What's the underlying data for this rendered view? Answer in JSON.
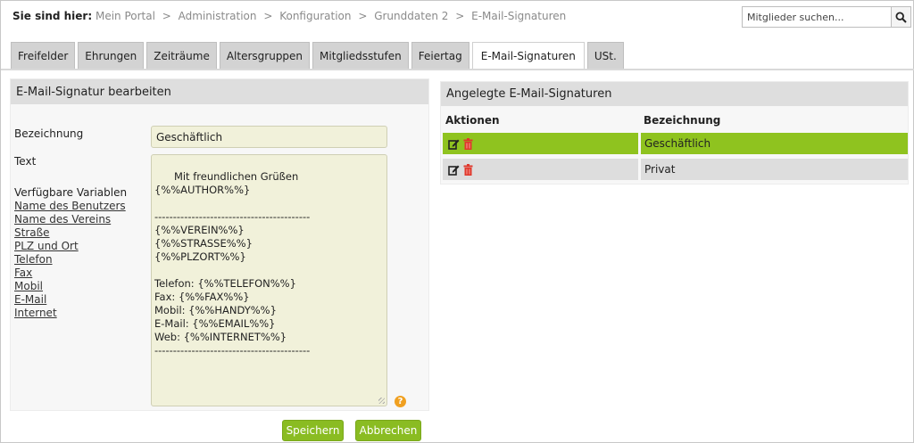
{
  "breadcrumb": {
    "lead": "Sie sind hier:",
    "items": [
      "Mein Portal",
      "Administration",
      "Konfiguration",
      "Grunddaten 2",
      "E-Mail-Signaturen"
    ],
    "separator": ">"
  },
  "search": {
    "placeholder": "Mitglieder suchen..."
  },
  "tabs": [
    "Freifelder",
    "Ehrungen",
    "Zeiträume",
    "Altersgruppen",
    "Mitgliedsstufen",
    "Feiertag",
    "E-Mail-Signaturen",
    "USt."
  ],
  "active_tab": "E-Mail-Signaturen",
  "edit_panel": {
    "title": "E-Mail-Signatur bearbeiten",
    "label_name": "Bezeichnung",
    "name_value": "Geschäftlich",
    "label_text": "Text",
    "text_value": "Mit freundlichen Grüßen\n{%%AUTHOR%%}\n\n------------------------------------------\n{%%VEREIN%%}\n{%%STRASSE%%}\n{%%PLZORT%%}\n\nTelefon: {%%TELEFON%%}\nFax: {%%FAX%%}\nMobil: {%%HANDY%%}\nE-Mail: {%%EMAIL%%}\nWeb: {%%INTERNET%%}\n------------------------------------------",
    "vars_title": "Verfügbare Variablen",
    "variables": [
      "Name des Benutzers",
      "Name des Vereins",
      "Straße",
      "PLZ und Ort",
      "Telefon",
      "Fax",
      "Mobil",
      "E-Mail",
      "Internet"
    ],
    "help_glyph": "?"
  },
  "buttons": {
    "save": "Speichern",
    "cancel": "Abbrechen"
  },
  "list_panel": {
    "title": "Angelegte E-Mail-Signaturen",
    "col_actions": "Aktionen",
    "col_name": "Bezeichnung",
    "rows": [
      {
        "name": "Geschäftlich",
        "selected": true
      },
      {
        "name": "Privat",
        "selected": false
      }
    ]
  },
  "colors": {
    "accent_green": "#8fc31f",
    "delete_red": "#e0382c"
  }
}
